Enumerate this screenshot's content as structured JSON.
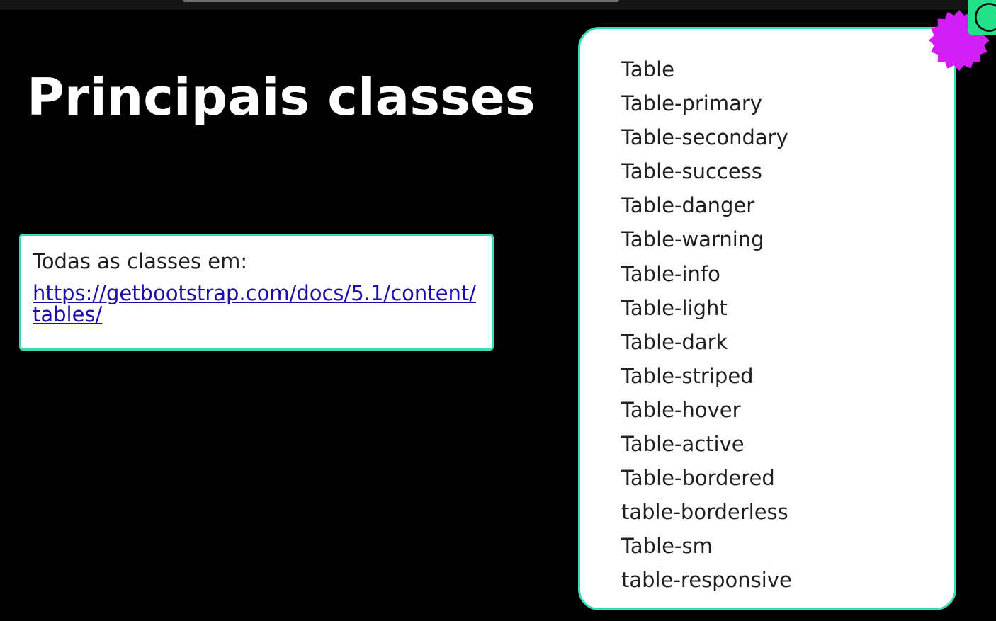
{
  "slide": {
    "title": "Principais classes",
    "link_card": {
      "intro": "Todas as classes em:",
      "url": "https://getbootstrap.com/docs/5.1/content/tables/"
    },
    "classes": [
      "Table",
      "Table-primary",
      "Table-secondary",
      "Table-success",
      "Table-danger",
      "Table-warning",
      "Table-info",
      "Table-light",
      "Table-dark",
      "Table-striped",
      "Table-hover",
      "Table-active",
      "Table-bordered",
      "table-borderless",
      "Table-sm",
      "table-responsive"
    ]
  },
  "colors": {
    "background": "#000000",
    "card_border": "#37dcb5",
    "badge": "#d21ff5",
    "corner_mark": "#25e08a",
    "link": "#1a0dab"
  },
  "icons": {
    "badge": "purple-starburst-badge",
    "corner": "green-corner-logo"
  }
}
